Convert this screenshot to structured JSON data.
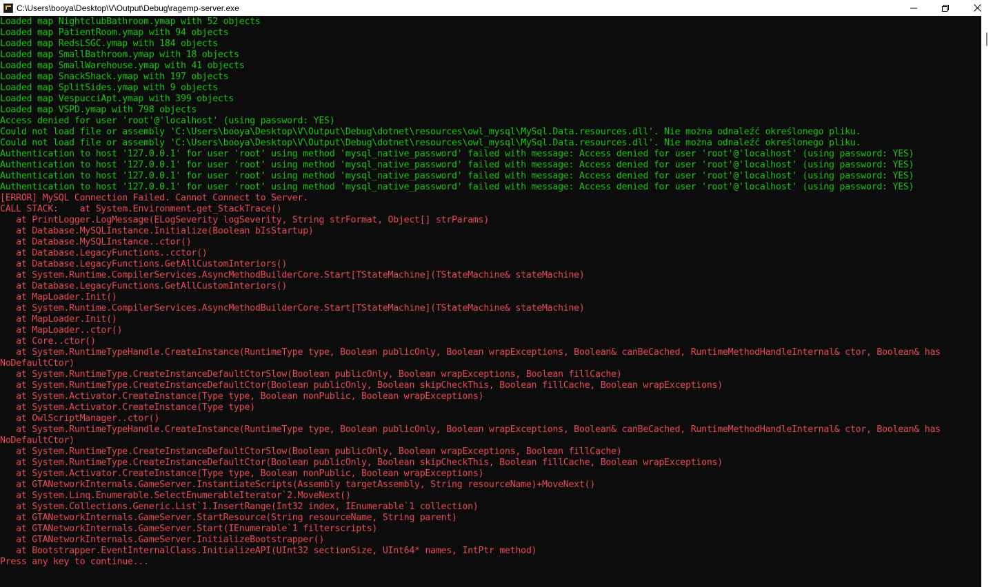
{
  "window": {
    "title": "C:\\Users\\booya\\Desktop\\V\\Output\\Debug\\ragemp-server.exe"
  },
  "icons": {
    "app": "console-app-icon",
    "minimize": "minimize-icon",
    "maximize": "restore-icon",
    "close": "close-icon"
  },
  "colors": {
    "background": "#0c0c0c",
    "success": "#16c60c",
    "error": "#e74856"
  },
  "console": {
    "lines": [
      {
        "text": "Loaded map NightclubBathroom.ymap with 52 objects",
        "color": "green"
      },
      {
        "text": "Loaded map PatientRoom.ymap with 94 objects",
        "color": "green"
      },
      {
        "text": "Loaded map RedsLSGC.ymap with 184 objects",
        "color": "green"
      },
      {
        "text": "Loaded map SmallBathroom.ymap with 18 objects",
        "color": "green"
      },
      {
        "text": "Loaded map SmallWarehouse.ymap with 41 objects",
        "color": "green"
      },
      {
        "text": "Loaded map SnackShack.ymap with 197 objects",
        "color": "green"
      },
      {
        "text": "Loaded map SplitSides.ymap with 9 objects",
        "color": "green"
      },
      {
        "text": "Loaded map VespucciApt.ymap with 399 objects",
        "color": "green"
      },
      {
        "text": "Loaded map VSPD.ymap with 798 objects",
        "color": "green"
      },
      {
        "text": "Access denied for user 'root'@'localhost' (using password: YES)",
        "color": "green"
      },
      {
        "text": "Could not load file or assembly 'C:\\Users\\booya\\Desktop\\V\\Output\\Debug\\dotnet\\resources\\owl_mysql\\MySql.Data.resources.dll'. Nie można odnaleźć określonego pliku.",
        "color": "green"
      },
      {
        "text": "Could not load file or assembly 'C:\\Users\\booya\\Desktop\\V\\Output\\Debug\\dotnet\\resources\\owl_mysql\\MySql.Data.resources.dll'. Nie można odnaleźć określonego pliku.",
        "color": "green"
      },
      {
        "text": "Authentication to host '127.0.0.1' for user 'root' using method 'mysql_native_password' failed with message: Access denied for user 'root'@'localhost' (using password: YES)",
        "color": "green"
      },
      {
        "text": "Authentication to host '127.0.0.1' for user 'root' using method 'mysql_native_password' failed with message: Access denied for user 'root'@'localhost' (using password: YES)",
        "color": "green"
      },
      {
        "text": "Authentication to host '127.0.0.1' for user 'root' using method 'mysql_native_password' failed with message: Access denied for user 'root'@'localhost' (using password: YES)",
        "color": "green"
      },
      {
        "text": "Authentication to host '127.0.0.1' for user 'root' using method 'mysql_native_password' failed with message: Access denied for user 'root'@'localhost' (using password: YES)",
        "color": "green"
      },
      {
        "text": "[ERROR] MySQL Connection Failed. Cannot Connect to Server.",
        "color": "red"
      },
      {
        "text": "CALL STACK:    at System.Environment.get_StackTrace()",
        "color": "red"
      },
      {
        "text": "   at PrintLogger.LogMessage(ELogSeverity logSeverity, String strFormat, Object[] strParams)",
        "color": "red"
      },
      {
        "text": "   at Database.MySQLInstance.Initialize(Boolean bIsStartup)",
        "color": "red"
      },
      {
        "text": "   at Database.MySQLInstance..ctor()",
        "color": "red"
      },
      {
        "text": "   at Database.LegacyFunctions..cctor()",
        "color": "red"
      },
      {
        "text": "   at Database.LegacyFunctions.GetAllCustomInteriors()",
        "color": "red"
      },
      {
        "text": "   at System.Runtime.CompilerServices.AsyncMethodBuilderCore.Start[TStateMachine](TStateMachine& stateMachine)",
        "color": "red"
      },
      {
        "text": "   at Database.LegacyFunctions.GetAllCustomInteriors()",
        "color": "red"
      },
      {
        "text": "   at MapLoader.Init()",
        "color": "red"
      },
      {
        "text": "   at System.Runtime.CompilerServices.AsyncMethodBuilderCore.Start[TStateMachine](TStateMachine& stateMachine)",
        "color": "red"
      },
      {
        "text": "   at MapLoader.Init()",
        "color": "red"
      },
      {
        "text": "   at MapLoader..ctor()",
        "color": "red"
      },
      {
        "text": "   at Core..ctor()",
        "color": "red"
      },
      {
        "text": "   at System.RuntimeTypeHandle.CreateInstance(RuntimeType type, Boolean publicOnly, Boolean wrapExceptions, Boolean& canBeCached, RuntimeMethodHandleInternal& ctor, Boolean& has",
        "color": "red"
      },
      {
        "text": "NoDefaultCtor)",
        "color": "red"
      },
      {
        "text": "   at System.RuntimeType.CreateInstanceDefaultCtorSlow(Boolean publicOnly, Boolean wrapExceptions, Boolean fillCache)",
        "color": "red"
      },
      {
        "text": "   at System.RuntimeType.CreateInstanceDefaultCtor(Boolean publicOnly, Boolean skipCheckThis, Boolean fillCache, Boolean wrapExceptions)",
        "color": "red"
      },
      {
        "text": "   at System.Activator.CreateInstance(Type type, Boolean nonPublic, Boolean wrapExceptions)",
        "color": "red"
      },
      {
        "text": "   at System.Activator.CreateInstance(Type type)",
        "color": "red"
      },
      {
        "text": "   at OwlScriptManager..ctor()",
        "color": "red"
      },
      {
        "text": "   at System.RuntimeTypeHandle.CreateInstance(RuntimeType type, Boolean publicOnly, Boolean wrapExceptions, Boolean& canBeCached, RuntimeMethodHandleInternal& ctor, Boolean& has",
        "color": "red"
      },
      {
        "text": "NoDefaultCtor)",
        "color": "red"
      },
      {
        "text": "   at System.RuntimeType.CreateInstanceDefaultCtorSlow(Boolean publicOnly, Boolean wrapExceptions, Boolean fillCache)",
        "color": "red"
      },
      {
        "text": "   at System.RuntimeType.CreateInstanceDefaultCtor(Boolean publicOnly, Boolean skipCheckThis, Boolean fillCache, Boolean wrapExceptions)",
        "color": "red"
      },
      {
        "text": "   at System.Activator.CreateInstance(Type type, Boolean nonPublic, Boolean wrapExceptions)",
        "color": "red"
      },
      {
        "text": "   at GTANetworkInternals.GameServer.InstantiateScripts(Assembly targetAssembly, String resourceName)+MoveNext()",
        "color": "red"
      },
      {
        "text": "   at System.Linq.Enumerable.SelectEnumerableIterator`2.MoveNext()",
        "color": "red"
      },
      {
        "text": "   at System.Collections.Generic.List`1.InsertRange(Int32 index, IEnumerable`1 collection)",
        "color": "red"
      },
      {
        "text": "   at GTANetworkInternals.GameServer.StartResource(String resourceName, String parent)",
        "color": "red"
      },
      {
        "text": "   at GTANetworkInternals.GameServer.Start(IEnumerable`1 filterscripts)",
        "color": "red"
      },
      {
        "text": "   at GTANetworkInternals.GameServer.InitializeBootstrapper()",
        "color": "red"
      },
      {
        "text": "   at Bootstrapper.EventInternalClass.InitializeAPI(UInt32 sectionSize, UInt64* names, IntPtr method)",
        "color": "red"
      },
      {
        "text": "Press any key to continue...",
        "color": "red"
      }
    ]
  }
}
